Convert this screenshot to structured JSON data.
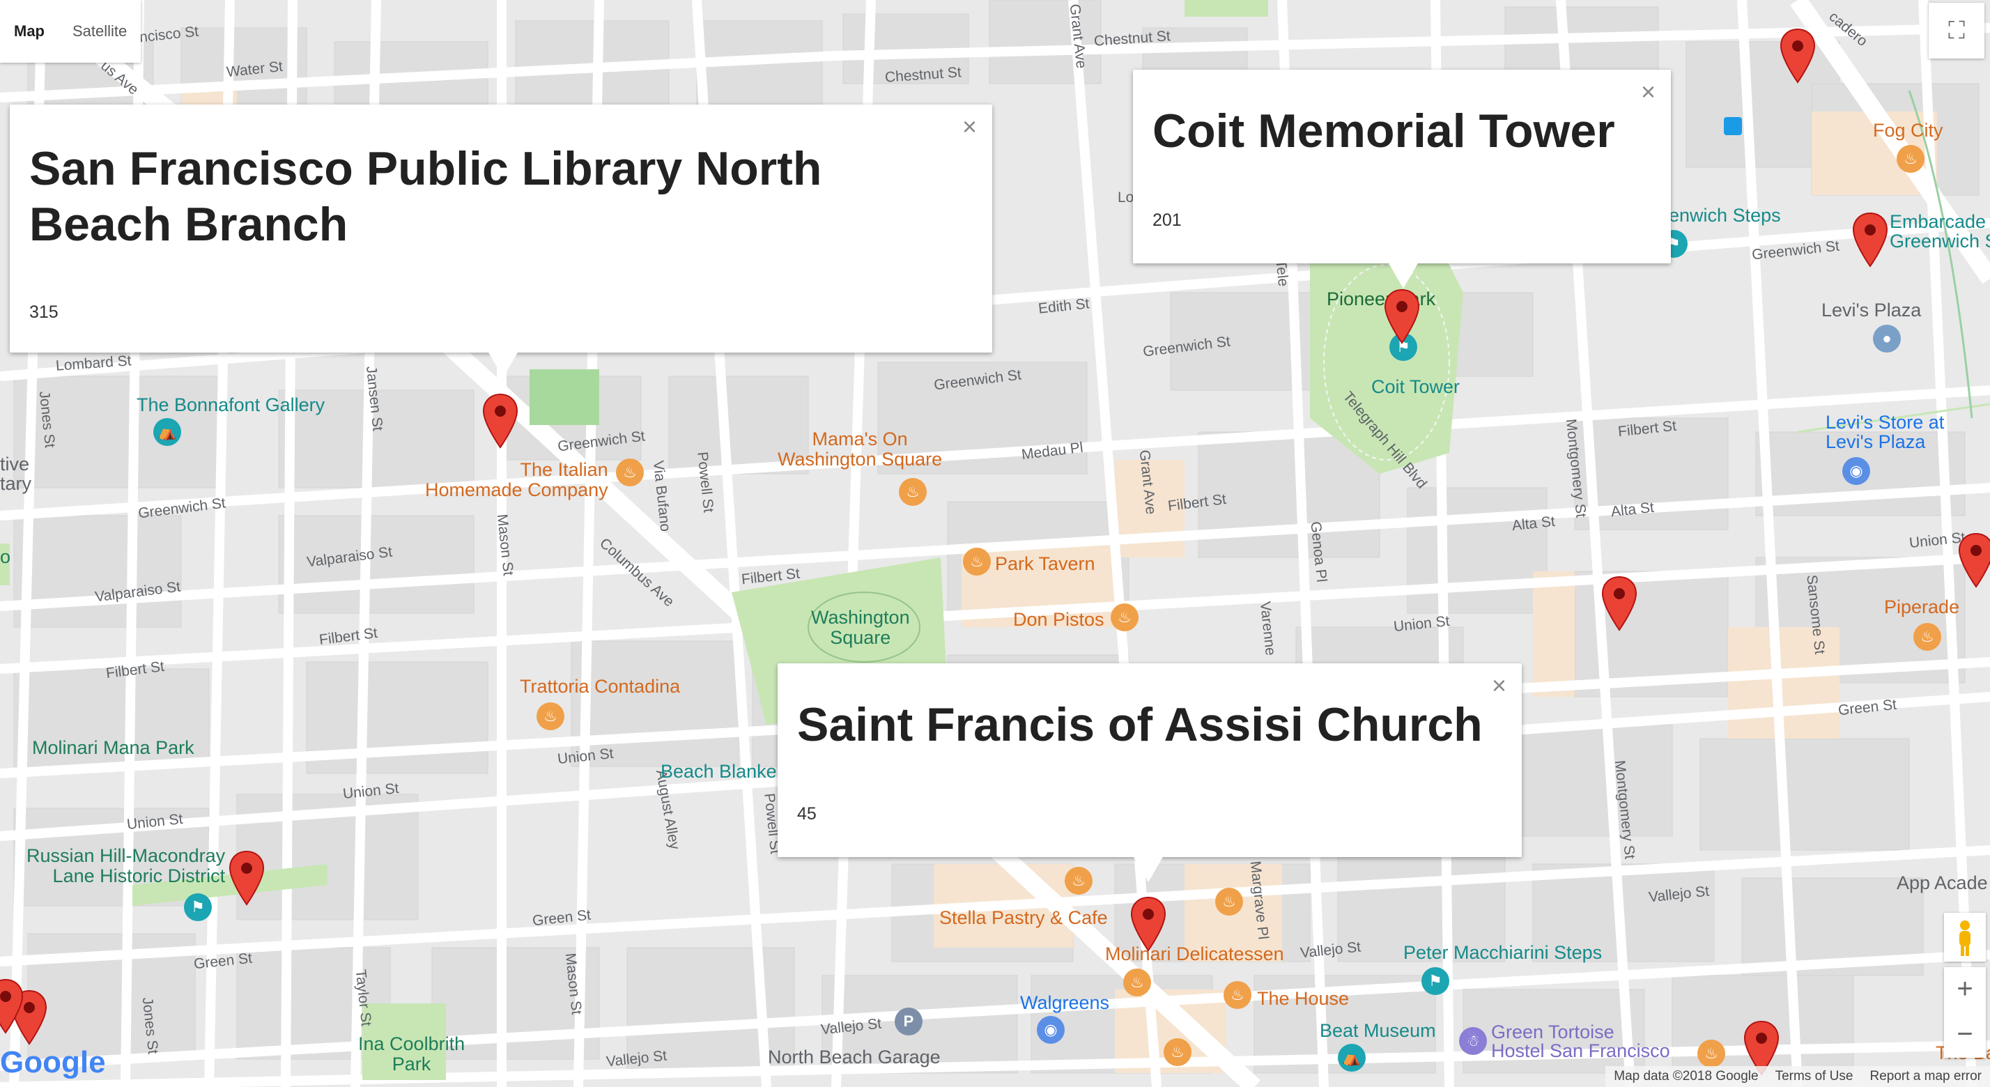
{
  "map_type": {
    "map_label": "Map",
    "satellite_label": "Satellite"
  },
  "info_windows": [
    {
      "title": "San Francisco Public Library North Beach Branch",
      "count": "315"
    },
    {
      "title": "Coit Memorial Tower",
      "count": "201"
    },
    {
      "title": "Saint Francis of Assisi Church",
      "count": "45"
    }
  ],
  "streets": {
    "s1": "ncisco St",
    "s2": "Water St",
    "s3": "us Ave",
    "s4": "Chestnut St",
    "s5": "Chestnut St",
    "s6": "Grant Ave",
    "s7": "Lombard St",
    "s8": "Edith St",
    "s9": "Greenwich St",
    "s10": "Greenwich St",
    "s11": "Greenwich St",
    "s12": "Greenwich St",
    "s13": "Jansen St",
    "s14": "Jones St",
    "s15": "Powell St",
    "s16": "Via Bufano",
    "s17": "Medau Pl",
    "s18": "Grant Ave",
    "s19": "Filbert St",
    "s20": "Valparaiso St",
    "s21": "Valparaiso St",
    "s22": "Mason St",
    "s23": "Columbus Ave",
    "s24": "Filbert St",
    "s25": "Filbert St",
    "s26": "Filbert St",
    "s27": "Union St",
    "s28": "Union St",
    "s29": "Union St",
    "s30": "August Alley",
    "s31": "Powell St",
    "s32": "Green St",
    "s33": "Green St",
    "s34": "Mason St",
    "s35": "Taylor St",
    "s36": "Jones St",
    "s37": "Vallejo St",
    "s38": "Vallejo St",
    "s39": "Vallejo St",
    "s40": "Montgomery St",
    "s41": "Montgomery St",
    "s42": "Alta St",
    "s43": "Alta St",
    "s44": "Union St",
    "s45": "Union St",
    "s46": "Sansome St",
    "s47": "Green St",
    "s48": "Vallejo St",
    "s49": "Greenwich St",
    "s50": "Filbert St",
    "s51": "Genoa Pl",
    "s52": "Varenne",
    "s53": "Margrave Pl",
    "s54": "Telegraph Hill Blvd",
    "s55": "Tele",
    "s56": "cadero",
    "s57": "Lo",
    "s58": "Vallejo St"
  },
  "pois": {
    "bonnafont": "The Bonnafont Gallery",
    "italian": "The Italian\nHomemade Company",
    "mamas": "Mama's On\nWashington Square",
    "park_tavern": "Park Tavern",
    "don_pistos": "Don Pistos",
    "washington_square": "Washington\nSquare",
    "trattoria": "Trattoria Contadina",
    "beach_blanket": "Beach Blanke",
    "molinari_park": "Molinari Mana Park",
    "russian_hill": "Russian Hill-Macondray\nLane Historic District",
    "stella": "Stella Pastry & Cafe",
    "molinari_deli": "Molinari Delicatessen",
    "walgreens": "Walgreens",
    "the_house": "The House",
    "peter": "Peter Macchiarini Steps",
    "beat_museum": "Beat Museum",
    "green_tortoise": "Green Tortoise\nHostel San Francisco",
    "nb_garage": "North Beach Garage",
    "ina": "Ina Coolbrith\nPark",
    "pioneer": "Pioneer Park",
    "coit": "Coit Tower",
    "greenwich_steps": "eenwich Steps",
    "fog_city": "Fog City",
    "embarcadero": "Embarcade\nGreenwich S",
    "levis_plaza": "Levi's Plaza",
    "levis_store": "Levi's Store at\nLevi's Plaza",
    "piperade": "Piperade",
    "app_acad": "App Acade",
    "the_ba": "The Ba",
    "ive": "tive\ntary",
    "o_green": "o"
  },
  "footer": {
    "data": "Map data ©2018 Google",
    "terms": "Terms of Use",
    "report": "Report a map error"
  },
  "logo": "Google",
  "colors": {
    "pin": "#ea4335",
    "park": "#c8e6b4",
    "road": "#ffffff",
    "block": "#e6e6e6",
    "accent_orange": "#d3691f"
  }
}
